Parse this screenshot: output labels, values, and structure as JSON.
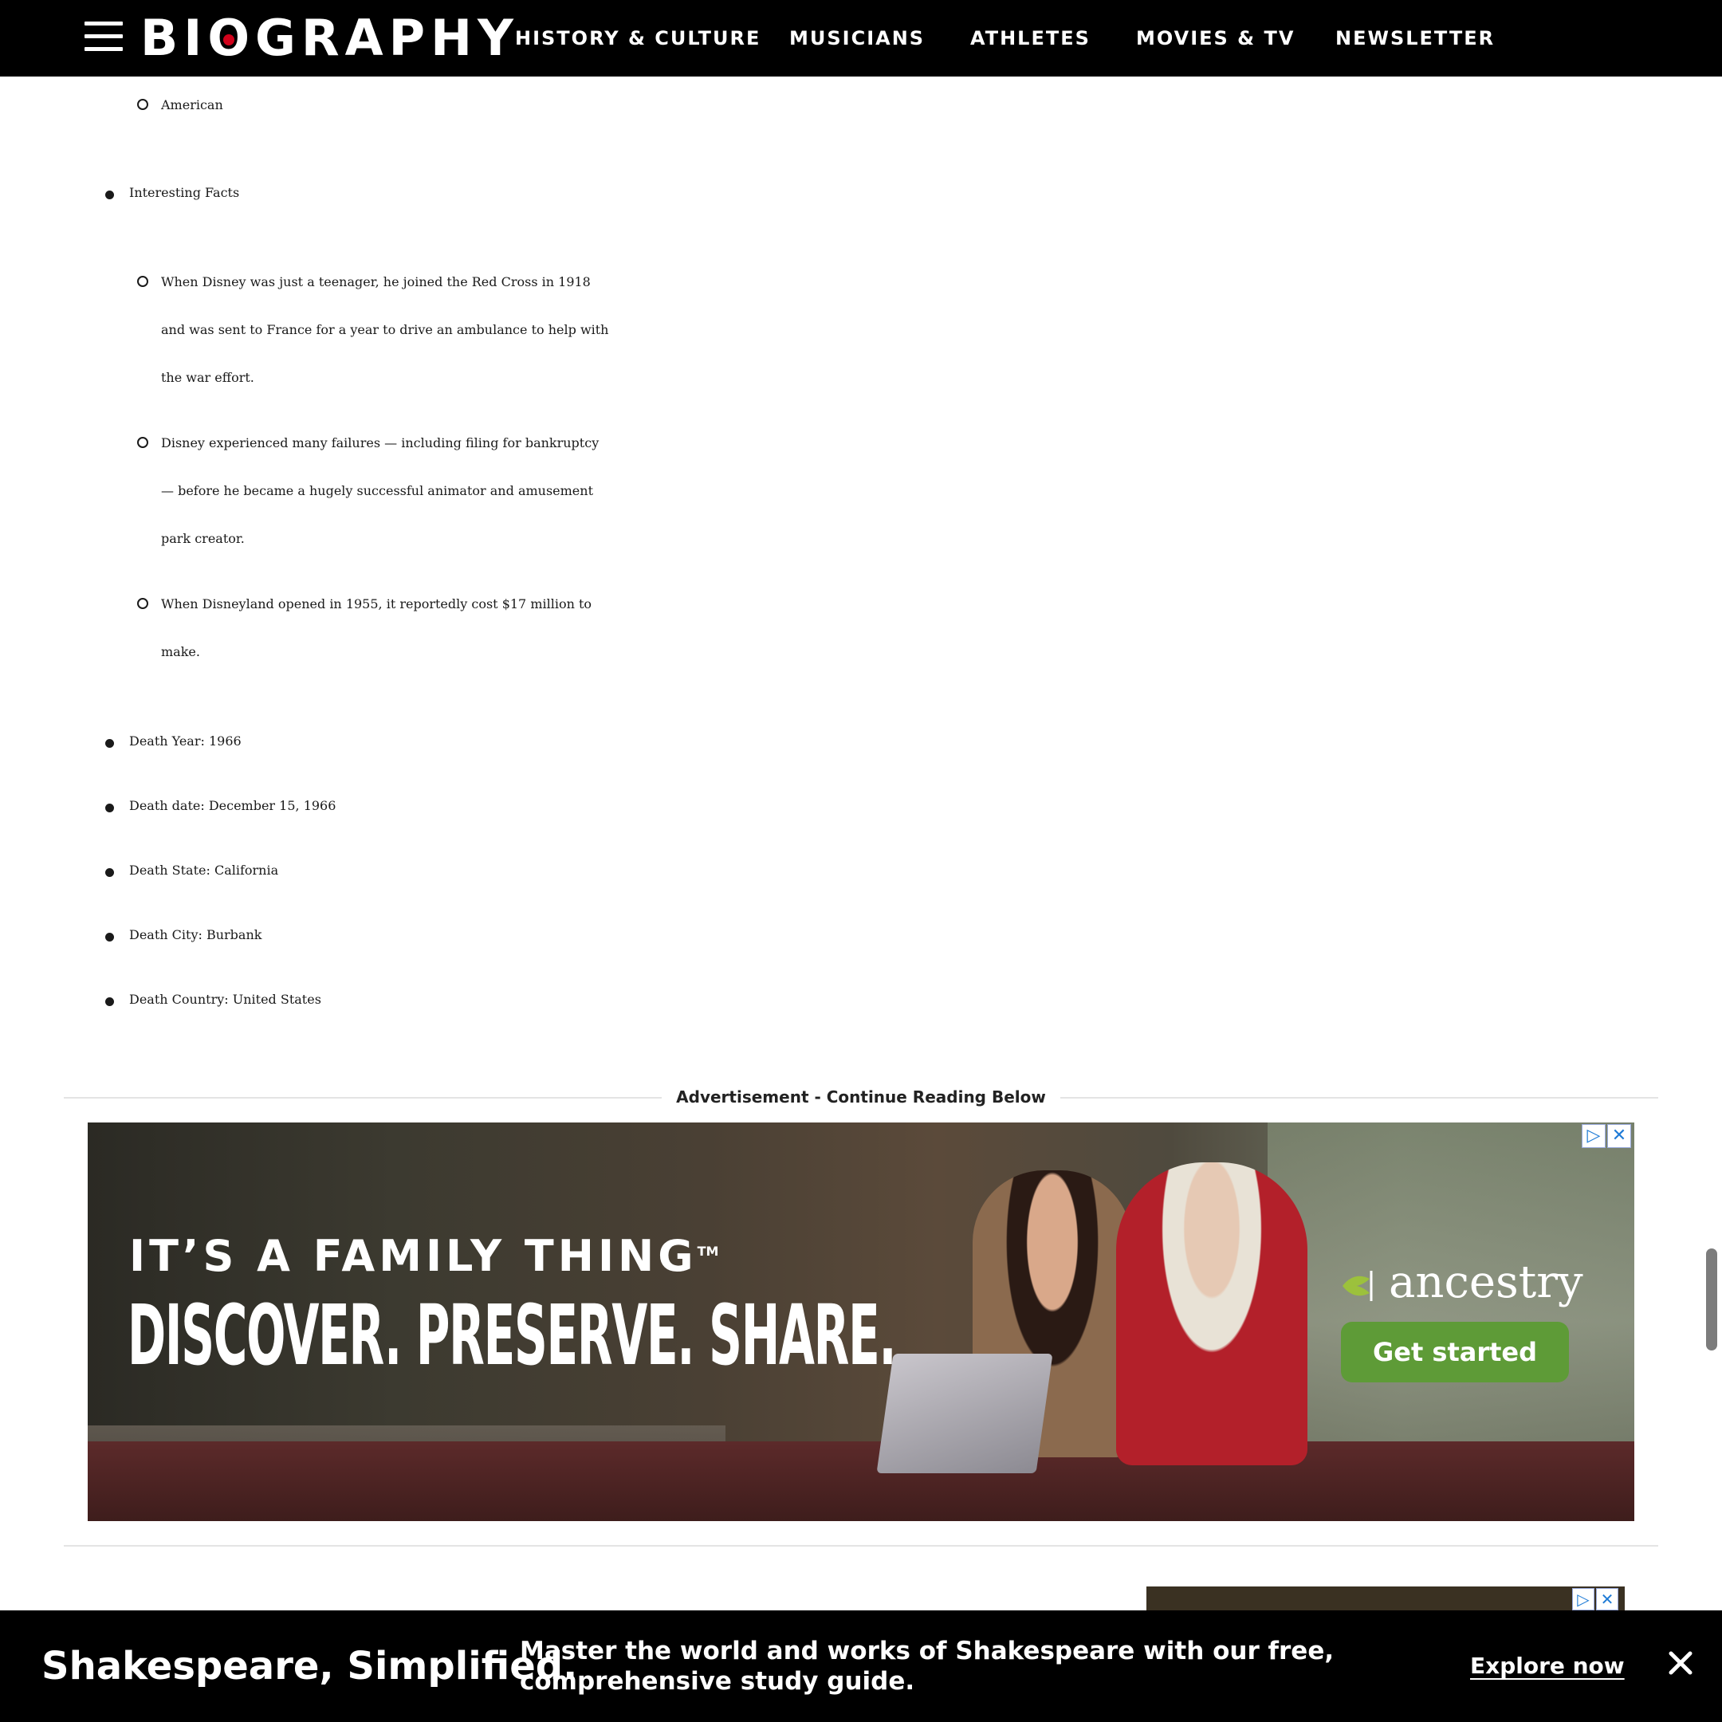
{
  "header": {
    "logo": "BIOGRAPHY",
    "nav": [
      "HISTORY & CULTURE",
      "MUSICIANS",
      "ATHLETES",
      "MOVIES & TV",
      "NEWSLETTER"
    ]
  },
  "article": {
    "nationality_sub": "American",
    "interesting_facts_label": "Interesting Facts",
    "facts": [
      "When Disney was just a teenager, he joined the Red Cross in 1918 and was sent to France for a year to drive an ambulance to help with the war effort.",
      "Disney experienced many failures — including filing for bankruptcy — before he became a hugely successful animator and amusement park creator.",
      "When Disneyland opened in 1955, it reportedly cost $17 million to make."
    ],
    "facts_lines": [
      [
        "When Disney was just a teenager, he joined the Red Cross in 1918",
        "and was sent to France for a year to drive an ambulance to help with",
        "the war effort."
      ],
      [
        "Disney experienced many failures — including filing for bankruptcy",
        "— before he became a hugely successful animator and amusement",
        "park creator."
      ],
      [
        "When Disneyland opened in 1955, it reportedly cost $17 million to",
        "make."
      ]
    ],
    "death_items": [
      "Death Year: 1966",
      "Death date: December 15, 1966",
      "Death State: California",
      "Death City: Burbank",
      "Death Country: United States"
    ]
  },
  "ad": {
    "label": "Advertisement - Continue Reading Below",
    "tagline": "IT’S A FAMILY THING",
    "tagline_mark": "TM",
    "headline": "DISCOVER. PRESERVE. SHARE.",
    "brand": "ancestry",
    "cta": "Get started",
    "adchoices_icon": "▷",
    "close_icon": "✕"
  },
  "promo": {
    "title": "Shakespeare, Simplified.",
    "description": "Master the world and works of Shakespeare with our free, comprehensive study guide.",
    "link": "Explore now"
  },
  "colors": {
    "header_bg": "#000000",
    "logo_dot": "#d0021b",
    "cta_green": "#5e9b37",
    "text": "#1a1a1a"
  }
}
